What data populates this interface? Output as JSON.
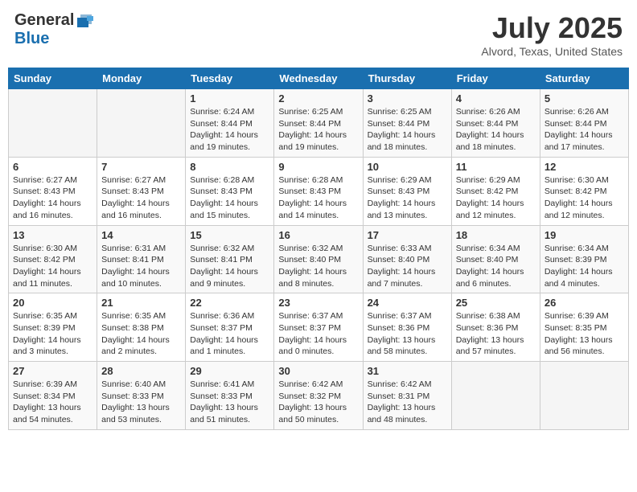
{
  "header": {
    "logo_general": "General",
    "logo_blue": "Blue",
    "month_year": "July 2025",
    "location": "Alvord, Texas, United States"
  },
  "weekdays": [
    "Sunday",
    "Monday",
    "Tuesday",
    "Wednesday",
    "Thursday",
    "Friday",
    "Saturday"
  ],
  "weeks": [
    [
      {
        "day": "",
        "info": ""
      },
      {
        "day": "",
        "info": ""
      },
      {
        "day": "1",
        "info": "Sunrise: 6:24 AM\nSunset: 8:44 PM\nDaylight: 14 hours and 19 minutes."
      },
      {
        "day": "2",
        "info": "Sunrise: 6:25 AM\nSunset: 8:44 PM\nDaylight: 14 hours and 19 minutes."
      },
      {
        "day": "3",
        "info": "Sunrise: 6:25 AM\nSunset: 8:44 PM\nDaylight: 14 hours and 18 minutes."
      },
      {
        "day": "4",
        "info": "Sunrise: 6:26 AM\nSunset: 8:44 PM\nDaylight: 14 hours and 18 minutes."
      },
      {
        "day": "5",
        "info": "Sunrise: 6:26 AM\nSunset: 8:44 PM\nDaylight: 14 hours and 17 minutes."
      }
    ],
    [
      {
        "day": "6",
        "info": "Sunrise: 6:27 AM\nSunset: 8:43 PM\nDaylight: 14 hours and 16 minutes."
      },
      {
        "day": "7",
        "info": "Sunrise: 6:27 AM\nSunset: 8:43 PM\nDaylight: 14 hours and 16 minutes."
      },
      {
        "day": "8",
        "info": "Sunrise: 6:28 AM\nSunset: 8:43 PM\nDaylight: 14 hours and 15 minutes."
      },
      {
        "day": "9",
        "info": "Sunrise: 6:28 AM\nSunset: 8:43 PM\nDaylight: 14 hours and 14 minutes."
      },
      {
        "day": "10",
        "info": "Sunrise: 6:29 AM\nSunset: 8:43 PM\nDaylight: 14 hours and 13 minutes."
      },
      {
        "day": "11",
        "info": "Sunrise: 6:29 AM\nSunset: 8:42 PM\nDaylight: 14 hours and 12 minutes."
      },
      {
        "day": "12",
        "info": "Sunrise: 6:30 AM\nSunset: 8:42 PM\nDaylight: 14 hours and 12 minutes."
      }
    ],
    [
      {
        "day": "13",
        "info": "Sunrise: 6:30 AM\nSunset: 8:42 PM\nDaylight: 14 hours and 11 minutes."
      },
      {
        "day": "14",
        "info": "Sunrise: 6:31 AM\nSunset: 8:41 PM\nDaylight: 14 hours and 10 minutes."
      },
      {
        "day": "15",
        "info": "Sunrise: 6:32 AM\nSunset: 8:41 PM\nDaylight: 14 hours and 9 minutes."
      },
      {
        "day": "16",
        "info": "Sunrise: 6:32 AM\nSunset: 8:40 PM\nDaylight: 14 hours and 8 minutes."
      },
      {
        "day": "17",
        "info": "Sunrise: 6:33 AM\nSunset: 8:40 PM\nDaylight: 14 hours and 7 minutes."
      },
      {
        "day": "18",
        "info": "Sunrise: 6:34 AM\nSunset: 8:40 PM\nDaylight: 14 hours and 6 minutes."
      },
      {
        "day": "19",
        "info": "Sunrise: 6:34 AM\nSunset: 8:39 PM\nDaylight: 14 hours and 4 minutes."
      }
    ],
    [
      {
        "day": "20",
        "info": "Sunrise: 6:35 AM\nSunset: 8:39 PM\nDaylight: 14 hours and 3 minutes."
      },
      {
        "day": "21",
        "info": "Sunrise: 6:35 AM\nSunset: 8:38 PM\nDaylight: 14 hours and 2 minutes."
      },
      {
        "day": "22",
        "info": "Sunrise: 6:36 AM\nSunset: 8:37 PM\nDaylight: 14 hours and 1 minutes."
      },
      {
        "day": "23",
        "info": "Sunrise: 6:37 AM\nSunset: 8:37 PM\nDaylight: 14 hours and 0 minutes."
      },
      {
        "day": "24",
        "info": "Sunrise: 6:37 AM\nSunset: 8:36 PM\nDaylight: 13 hours and 58 minutes."
      },
      {
        "day": "25",
        "info": "Sunrise: 6:38 AM\nSunset: 8:36 PM\nDaylight: 13 hours and 57 minutes."
      },
      {
        "day": "26",
        "info": "Sunrise: 6:39 AM\nSunset: 8:35 PM\nDaylight: 13 hours and 56 minutes."
      }
    ],
    [
      {
        "day": "27",
        "info": "Sunrise: 6:39 AM\nSunset: 8:34 PM\nDaylight: 13 hours and 54 minutes."
      },
      {
        "day": "28",
        "info": "Sunrise: 6:40 AM\nSunset: 8:33 PM\nDaylight: 13 hours and 53 minutes."
      },
      {
        "day": "29",
        "info": "Sunrise: 6:41 AM\nSunset: 8:33 PM\nDaylight: 13 hours and 51 minutes."
      },
      {
        "day": "30",
        "info": "Sunrise: 6:42 AM\nSunset: 8:32 PM\nDaylight: 13 hours and 50 minutes."
      },
      {
        "day": "31",
        "info": "Sunrise: 6:42 AM\nSunset: 8:31 PM\nDaylight: 13 hours and 48 minutes."
      },
      {
        "day": "",
        "info": ""
      },
      {
        "day": "",
        "info": ""
      }
    ]
  ]
}
